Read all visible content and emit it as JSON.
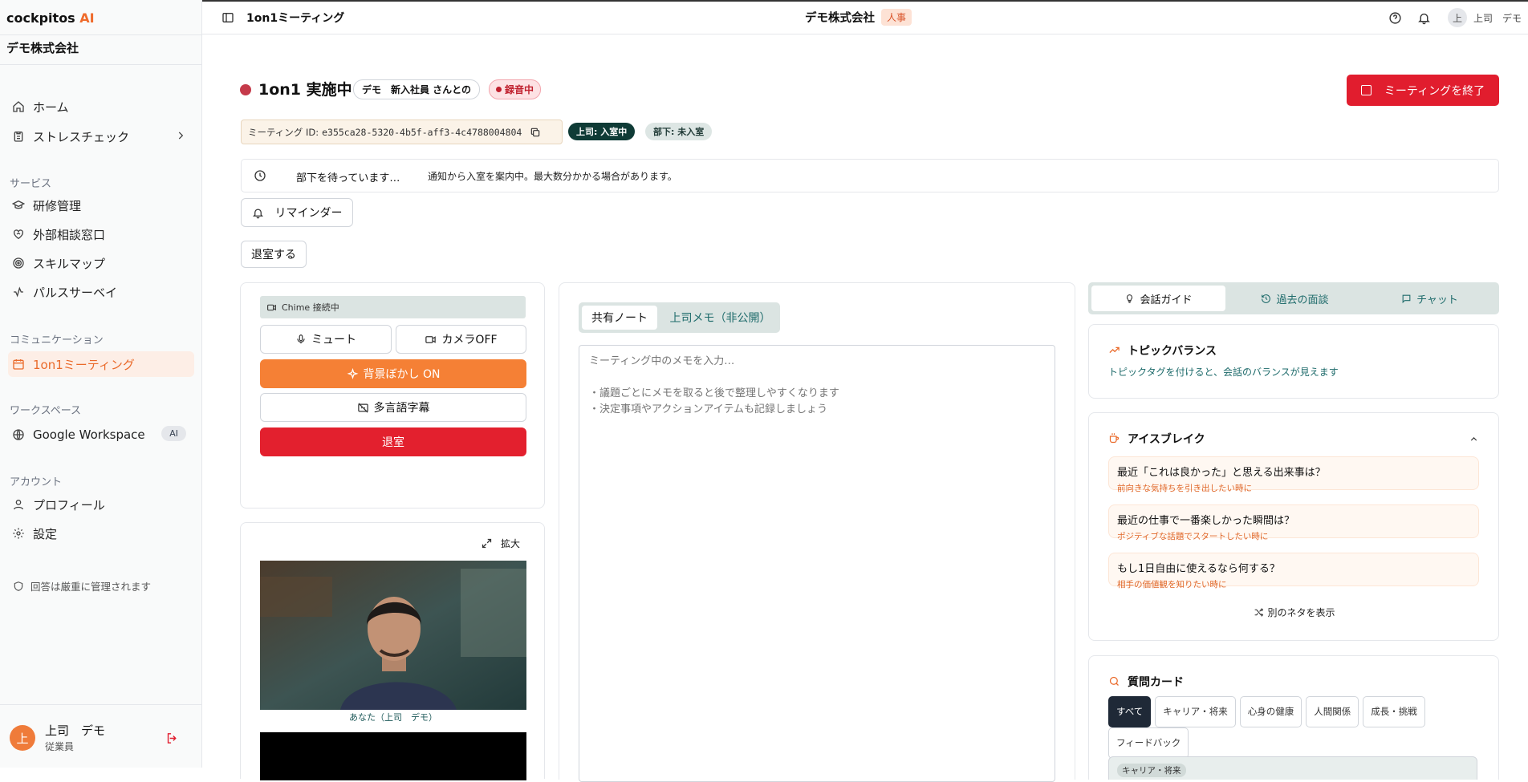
{
  "app": {
    "logo_text": "cockpitos",
    "logo_ai": "AI",
    "company": "デモ株式会社"
  },
  "sidebar": {
    "home": "ホーム",
    "stress_check": "ストレスチェック",
    "section_services": "サービス",
    "training": "研修管理",
    "consult": "外部相談窓口",
    "skillmap": "スキルマップ",
    "pulse": "パルスサーベイ",
    "section_comm": "コミュニケーション",
    "one_on_one": "1on1ミーティング",
    "section_workspace": "ワークスペース",
    "google_workspace": "Google Workspace",
    "google_badge": "AI",
    "section_account": "アカウント",
    "profile": "プロフィール",
    "settings": "設定",
    "privacy_note": "回答は厳重に管理されます",
    "user_initial": "上",
    "user_name": "上司　デモ",
    "user_role": "従業員"
  },
  "topbar": {
    "page_title": "1on1ミーティング",
    "company": "デモ株式会社",
    "dept_badge": "人事",
    "user_initial": "上",
    "user_name": "上司　デモ"
  },
  "meeting": {
    "title": "1on1 実施中",
    "partner": "デモ　新入社員 さんとの",
    "recording": "録音中",
    "end_button": "ミーティングを終了",
    "id_label": "ミーティング ID:",
    "id_value": "e355ca28-5320-4b5f-aff3-4c4788004804",
    "boss_status": "上司: 入室中",
    "sub_status": "部下: 未入室",
    "waiting": "部下を待っています…",
    "waiting_note": "通知から入室を案内中。最大数分かかる場合があります。",
    "reminder": "リマインダー",
    "leave_room": "退室する"
  },
  "controls": {
    "chime": "Chime 接続中",
    "mute": "ミュート",
    "camera": "カメラOFF",
    "blur": "背景ぼかし ON",
    "captions": "多言語字幕",
    "leave": "退室",
    "expand": "拡大",
    "self_caption": "あなた（上司　デモ）"
  },
  "notes": {
    "tab_shared": "共有ノート",
    "tab_private": "上司メモ（非公開）",
    "placeholder": "ミーティング中のメモを入力…\n\n・議題ごとにメモを取ると後で整理しやすくなります\n・決定事項やアクションアイテムも記録しましょう"
  },
  "right": {
    "tab_guide": "会話ガイド",
    "tab_past": "過去の面談",
    "tab_chat": "チャット",
    "topic_title": "トピックバランス",
    "topic_desc": "トピックタグを付けると、会話のバランスが見えます",
    "ice_title": "アイスブレイク",
    "ice": [
      {
        "q": "最近「これは良かった」と思える出来事は？",
        "hint": "前向きな気持ちを引き出したい時に"
      },
      {
        "q": "最近の仕事で一番楽しかった瞬間は？",
        "hint": "ポジティブな話題でスタートしたい時に"
      },
      {
        "q": "もし1日自由に使えるなら何する？",
        "hint": "相手の価値観を知りたい時に"
      }
    ],
    "shuffle": "別のネタを表示",
    "qcard_title": "質問カード",
    "tags": [
      "すべて",
      "キャリア・将来",
      "心身の健康",
      "人間関係",
      "成長・挑戦",
      "フィードバック"
    ],
    "card_tag": "キャリア・将来"
  },
  "colors": {
    "accent": "#ea6a2a",
    "danger": "#e11d2e",
    "dark_badge": "#0f3b36"
  }
}
